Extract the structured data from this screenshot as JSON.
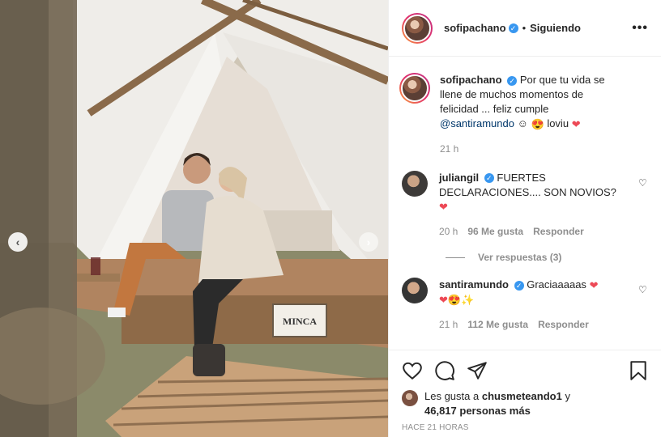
{
  "post": {
    "author": "sofipachano",
    "follow_sep": "•",
    "follow_status": "Siguiendo",
    "more_icon": "•••",
    "photo_sign": "MINCA"
  },
  "caption": {
    "username": "sofipachano",
    "text_part1": "Por que tu vida se llene de muchos momentos de felicidad ... feliz cumple",
    "mention": "@santiramundo",
    "text_part2": "☺",
    "emoji1": "😍",
    "text_part3": "loviu",
    "emoji2": "❤",
    "time": "21 h"
  },
  "comments": [
    {
      "username": "juliangil",
      "text": "FUERTES DECLARACIONES.... SON NOVIOS?",
      "emoji": "❤",
      "time": "20 h",
      "likes": "96 Me gusta",
      "reply": "Responder",
      "view_replies": "Ver respuestas (3)"
    },
    {
      "username": "santiramundo",
      "text": "Graciaaaaas",
      "emoji": "❤",
      "emoji_line": "❤😍✨",
      "time": "21 h",
      "likes": "112 Me gusta",
      "reply": "Responder"
    }
  ],
  "likes_summary": {
    "prefix": "Les gusta a",
    "user": "chusmeteando1",
    "joiner": "y",
    "count": "46,817 personas más"
  },
  "post_time": "HACE 21 HORAS",
  "nav": {
    "prev": "‹",
    "next": "›"
  },
  "icons": {
    "like": "heart-icon",
    "comment": "comment-icon",
    "share": "share-icon",
    "save": "bookmark-icon",
    "verified": "verified-badge-icon"
  },
  "colors": {
    "heart": "#ed4956",
    "link": "#00376b",
    "verified": "#3897f0",
    "meta": "#8e8e8e"
  }
}
